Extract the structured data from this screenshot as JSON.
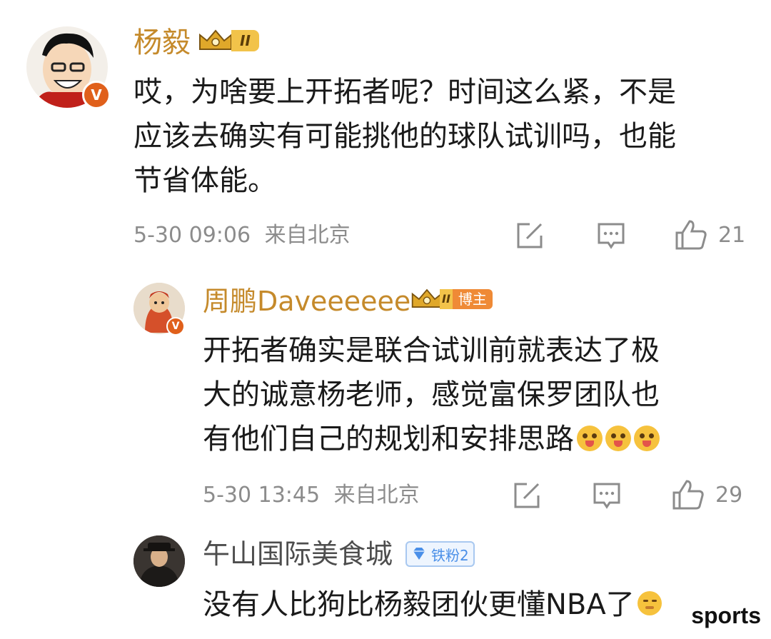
{
  "comments": [
    {
      "name": "杨毅",
      "level_badge": "II",
      "text_lines": [
        "哎，为啥要上开拓者呢？时间这么紧，不是",
        "应该去确实有可能挑他的球队试训吗，也能",
        "节省体能。"
      ],
      "date": "5-30 09:06",
      "location": "来自北京",
      "likes": "21",
      "verified_badge": "V"
    },
    {
      "name": "周鹏Daveeeeee",
      "level_badge": "II",
      "role_tag": "博主",
      "text_lines": [
        "开拓者确实是联合试训前就表达了极",
        "大的诚意杨老师，感觉富保罗团队也",
        "有他们自己的规划和安排思路"
      ],
      "date": "5-30 13:45",
      "location": "来自北京",
      "likes": "29",
      "verified_badge": "V"
    },
    {
      "name": "午山国际美食城",
      "fan_tag": "铁粉2",
      "text_lines": [
        "没有人比狗比杨毅团伙更懂NBA了"
      ]
    }
  ],
  "watermark": "sports",
  "colors": {
    "gold": "#c58a2b",
    "orange": "#e0601b",
    "meta": "#8c8c8c",
    "fan_blue": "#4a8fe8"
  },
  "icons": [
    "repost-icon",
    "comment-icon",
    "like-icon",
    "crown-icon",
    "diamond-icon",
    "emoji-tongue",
    "emoji-smile"
  ]
}
